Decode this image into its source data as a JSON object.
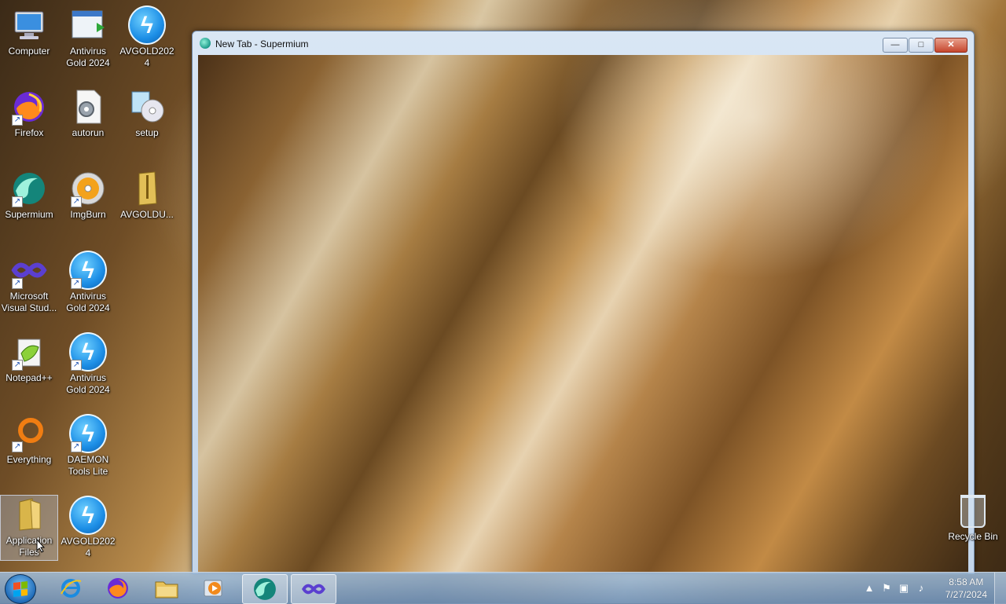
{
  "desktop": {
    "icons": [
      {
        "label": "Computer",
        "icon": "computer-icon"
      },
      {
        "label": "Antivirus Gold 2024",
        "icon": "installer-icon"
      },
      {
        "label": "AVGOLD2024",
        "icon": "lightning-icon"
      },
      {
        "label": "Firefox",
        "icon": "firefox-icon"
      },
      {
        "label": "autorun",
        "icon": "settings-file-icon"
      },
      {
        "label": "setup",
        "icon": "setup-icon"
      },
      {
        "label": "Supermium",
        "icon": "supermium-icon"
      },
      {
        "label": "ImgBurn",
        "icon": "imgburn-icon"
      },
      {
        "label": "AVGOLDU...",
        "icon": "zip-folder-icon"
      },
      {
        "label": "Microsoft Visual Stud...",
        "icon": "visual-studio-icon"
      },
      {
        "label": "Antivirus Gold 2024",
        "icon": "lightning-icon"
      },
      {
        "label": "Notepad++",
        "icon": "notepadpp-icon"
      },
      {
        "label": "Antivirus Gold 2024",
        "icon": "lightning-icon"
      },
      {
        "label": "Everything",
        "icon": "everything-icon"
      },
      {
        "label": "DAEMON Tools Lite",
        "icon": "lightning-icon"
      },
      {
        "label": "Application Files",
        "icon": "folder-icon"
      },
      {
        "label": "AVGOLD2024",
        "icon": "lightning-icon"
      }
    ],
    "recycle_bin": {
      "label": "Recycle Bin",
      "icon": "recycle-bin-icon"
    }
  },
  "window": {
    "title": "New Tab - Supermium",
    "controls": {
      "minimize": "—",
      "maximize": "□",
      "close": "✕"
    }
  },
  "taskbar": {
    "pinned": [
      {
        "name": "internet-explorer",
        "icon": "ie-icon"
      },
      {
        "name": "firefox",
        "icon": "firefox-icon"
      },
      {
        "name": "file-explorer",
        "icon": "folder-icon"
      },
      {
        "name": "media-player",
        "icon": "media-player-icon"
      },
      {
        "name": "supermium",
        "icon": "supermium-icon",
        "active": true
      },
      {
        "name": "visual-studio",
        "icon": "visual-studio-icon",
        "active": true
      }
    ],
    "clock": {
      "time": "8:58 AM",
      "date": "7/27/2024"
    }
  }
}
